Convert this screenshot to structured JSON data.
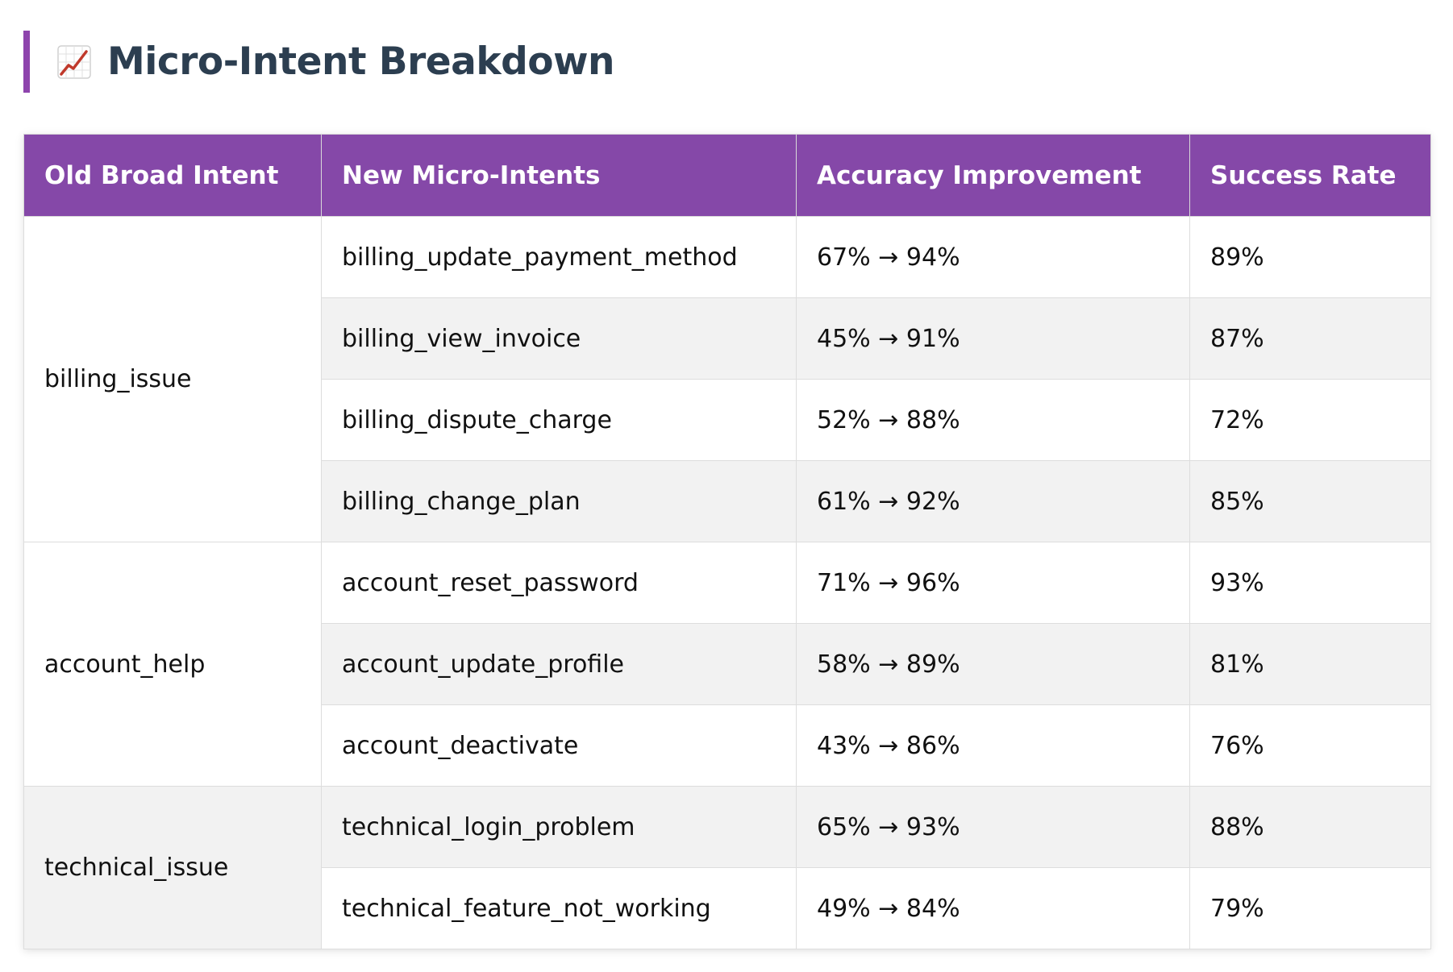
{
  "heading": {
    "icon": "chart-increasing-icon",
    "title": "Micro-Intent Breakdown",
    "accent_color": "#8e44ad",
    "title_color": "#2c3e50"
  },
  "table": {
    "header_color": "#8548a8",
    "stripe_color": "#f2f2f2",
    "columns": [
      "Old Broad Intent",
      "New Micro-Intents",
      "Accuracy Improvement",
      "Success Rate"
    ],
    "groups": [
      {
        "broad_intent": "billing_issue",
        "rows": [
          {
            "micro_intent": "billing_update_payment_method",
            "accuracy": "67% → 94%",
            "success_rate": "89%"
          },
          {
            "micro_intent": "billing_view_invoice",
            "accuracy": "45% → 91%",
            "success_rate": "87%"
          },
          {
            "micro_intent": "billing_dispute_charge",
            "accuracy": "52% → 88%",
            "success_rate": "72%"
          },
          {
            "micro_intent": "billing_change_plan",
            "accuracy": "61% → 92%",
            "success_rate": "85%"
          }
        ]
      },
      {
        "broad_intent": "account_help",
        "rows": [
          {
            "micro_intent": "account_reset_password",
            "accuracy": "71% → 96%",
            "success_rate": "93%"
          },
          {
            "micro_intent": "account_update_profile",
            "accuracy": "58% → 89%",
            "success_rate": "81%"
          },
          {
            "micro_intent": "account_deactivate",
            "accuracy": "43% → 86%",
            "success_rate": "76%"
          }
        ]
      },
      {
        "broad_intent": "technical_issue",
        "rows": [
          {
            "micro_intent": "technical_login_problem",
            "accuracy": "65% → 93%",
            "success_rate": "88%"
          },
          {
            "micro_intent": "technical_feature_not_working",
            "accuracy": "49% → 84%",
            "success_rate": "79%"
          }
        ]
      }
    ]
  }
}
